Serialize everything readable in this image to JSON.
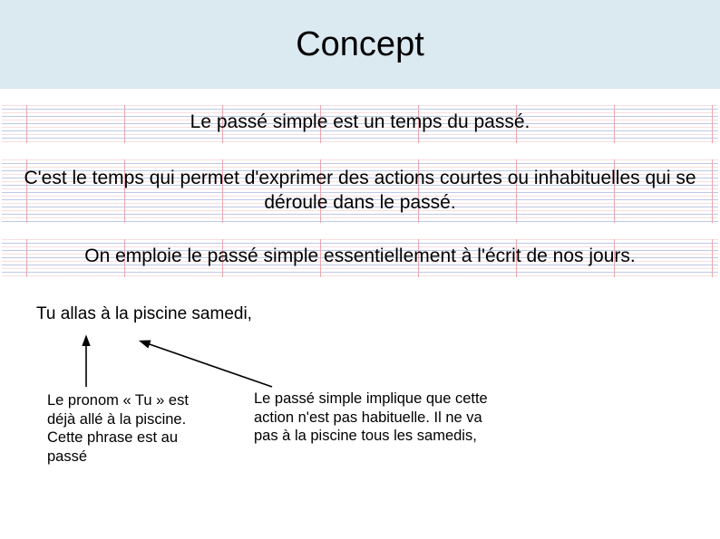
{
  "title": "Concept",
  "line1": "Le passé simple est un temps du passé.",
  "line2": "C'est le temps qui permet d'exprimer des actions courtes ou inhabituelles qui se déroule dans le passé.",
  "line3": "On emploie le passé simple essentiellement à l'écrit de nos jours.",
  "example": "Tu allas à la piscine samedi,",
  "note1": "Le pronom « Tu » est déjà allé à la piscine. Cette phrase est au passé",
  "note2": "Le passé simple implique que cette action n'est pas habituelle. Il ne va pas à la piscine tous les samedis,"
}
